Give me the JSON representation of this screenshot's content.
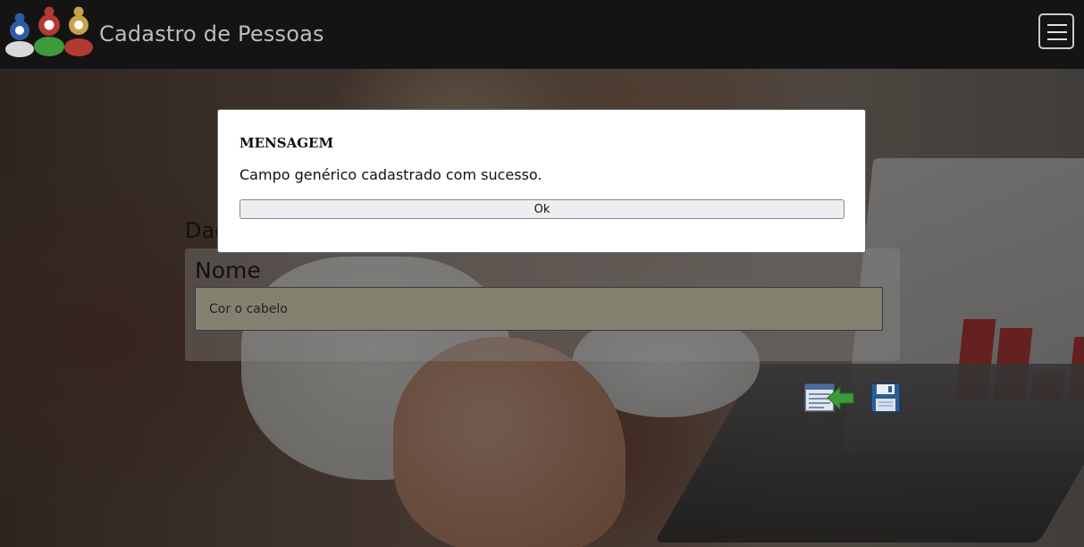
{
  "navbar": {
    "brand": "Cadastro de Pessoas",
    "logo_icon": "people-group-icon",
    "menu_icon": "hamburger-menu-icon"
  },
  "form": {
    "section_title": "Dados",
    "field_label": "Nome",
    "field_value": "Cor o cabelo"
  },
  "actions": {
    "back_icon": "back-to-list-icon",
    "save_icon": "floppy-disk-save-icon"
  },
  "modal": {
    "title": "MENSAGEM",
    "message": "Campo genérico cadastrado com sucesso.",
    "ok_label": "Ok"
  },
  "colors": {
    "navbar_bg": "#141414",
    "logo_blue": "#2f5aa8",
    "logo_green": "#3f9a3c",
    "logo_red": "#b23a32",
    "logo_gold": "#c9a24a"
  }
}
